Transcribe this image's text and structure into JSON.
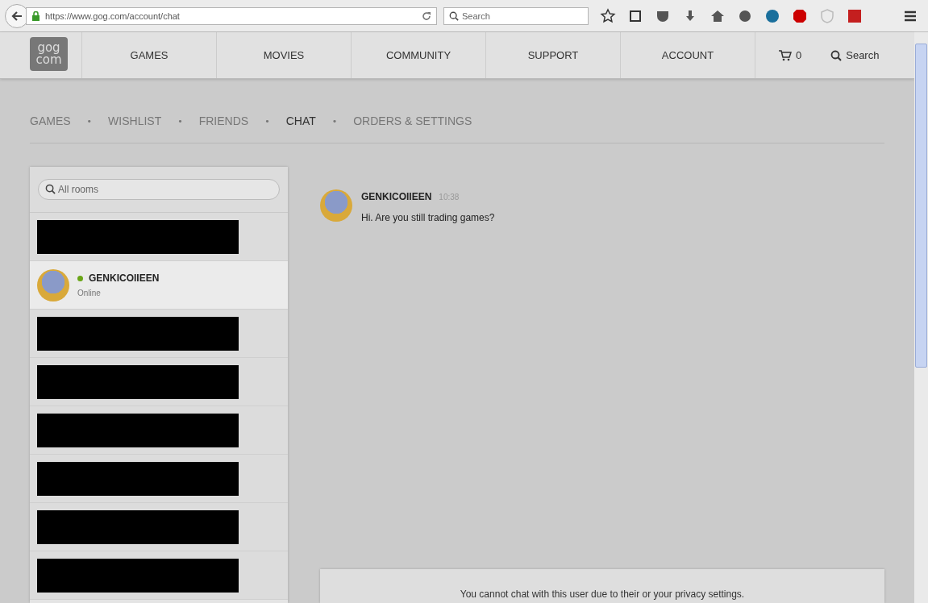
{
  "browser": {
    "url": "https://www.gog.com/account/chat",
    "search_placeholder": "Search"
  },
  "header": {
    "logo_top": "gog",
    "logo_bottom": "com",
    "nav": [
      "GAMES",
      "MOVIES",
      "COMMUNITY",
      "SUPPORT",
      "ACCOUNT"
    ],
    "cart_count": "0",
    "search_label": "Search"
  },
  "subnav_separator": "•",
  "subnav": [
    {
      "label": "GAMES",
      "selected": false
    },
    {
      "label": "WISHLIST",
      "selected": false
    },
    {
      "label": "FRIENDS",
      "selected": false
    },
    {
      "label": "CHAT",
      "selected": true
    },
    {
      "label": "ORDERS & SETTINGS",
      "selected": false
    }
  ],
  "rooms": {
    "placeholder": "All rooms",
    "items": [
      {
        "kind": "redacted"
      },
      {
        "kind": "user",
        "name": "GENKICOIIEEN",
        "status": "Online",
        "online": true,
        "selected": true
      },
      {
        "kind": "redacted"
      },
      {
        "kind": "redacted"
      },
      {
        "kind": "redacted"
      },
      {
        "kind": "redacted"
      },
      {
        "kind": "redacted"
      },
      {
        "kind": "redacted"
      }
    ]
  },
  "messages": [
    {
      "author": "GENKICOIIEEN",
      "time": "10:38",
      "text": "Hi. Are you still trading games?"
    }
  ],
  "notice": "You cannot chat with this user due to their or your privacy settings."
}
